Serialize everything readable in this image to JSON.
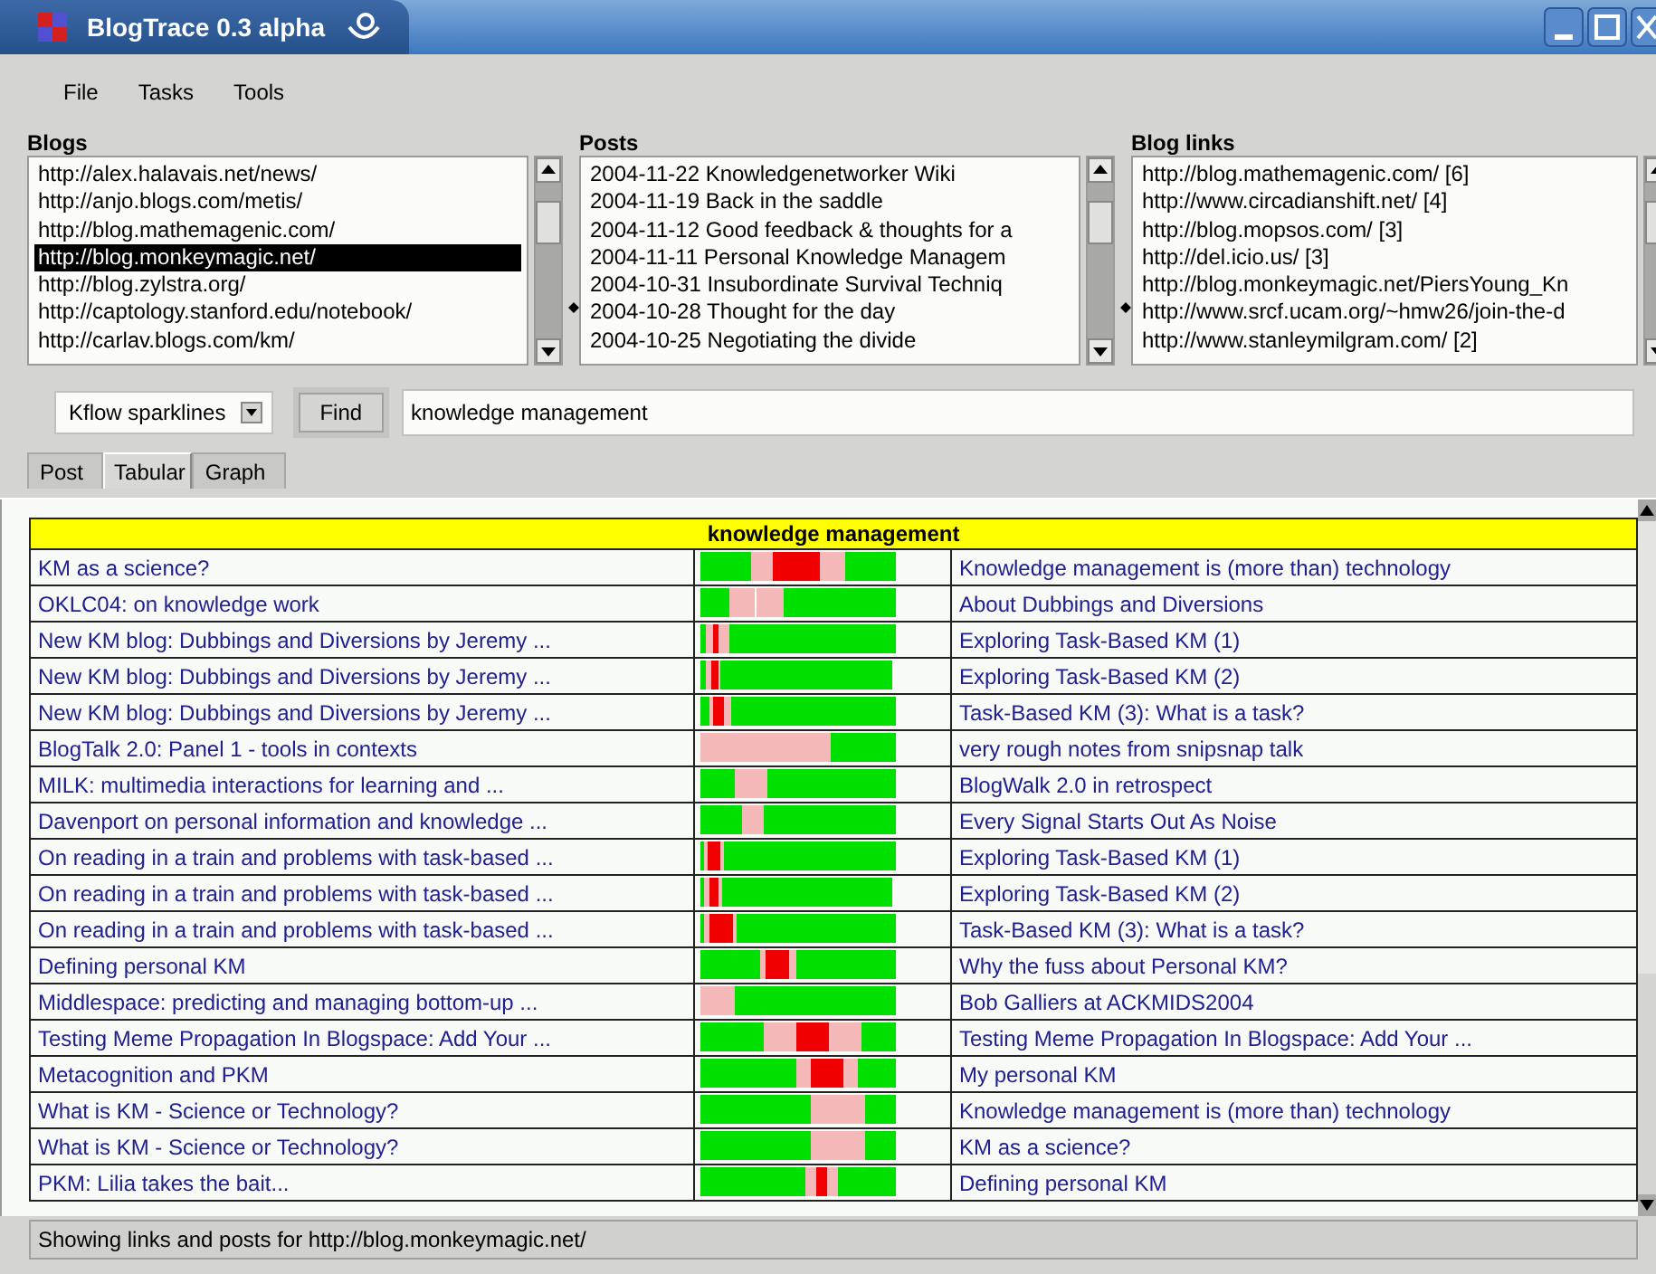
{
  "window": {
    "title": "BlogTrace 0.3 alpha"
  },
  "menu": [
    {
      "label": "File"
    },
    {
      "label": "Tasks"
    },
    {
      "label": "Tools"
    }
  ],
  "panels": [
    {
      "label": "Blogs",
      "items": [
        {
          "text": "http://alex.halavais.net/news/",
          "selected": false
        },
        {
          "text": "http://anjo.blogs.com/metis/",
          "selected": false
        },
        {
          "text": "http://blog.mathemagenic.com/",
          "selected": false
        },
        {
          "text": "http://blog.monkeymagic.net/",
          "selected": true
        },
        {
          "text": "http://blog.zylstra.org/",
          "selected": false
        },
        {
          "text": "http://captology.stanford.edu/notebook/",
          "selected": false
        },
        {
          "text": "http://carlav.blogs.com/km/",
          "selected": false
        }
      ]
    },
    {
      "label": "Posts",
      "items": [
        {
          "text": "2004-11-22 Knowledgenetworker Wiki",
          "selected": false
        },
        {
          "text": "2004-11-19 Back in the saddle",
          "selected": false
        },
        {
          "text": "2004-11-12 Good feedback & thoughts for a",
          "selected": false
        },
        {
          "text": "2004-11-11 Personal Knowledge Managem",
          "selected": false
        },
        {
          "text": "2004-10-31 Insubordinate Survival Techniq",
          "selected": false
        },
        {
          "text": "2004-10-28 Thought for the day",
          "selected": false
        },
        {
          "text": "2004-10-25 Negotiating the divide",
          "selected": false
        }
      ]
    },
    {
      "label": "Blog links",
      "items": [
        {
          "text": "http://blog.mathemagenic.com/ [6]",
          "selected": false
        },
        {
          "text": "http://www.circadianshift.net/ [4]",
          "selected": false
        },
        {
          "text": "http://blog.mopsos.com/ [3]",
          "selected": false
        },
        {
          "text": "http://del.icio.us/ [3]",
          "selected": false
        },
        {
          "text": "http://blog.monkeymagic.net/PiersYoung_Kn",
          "selected": false
        },
        {
          "text": "http://www.srcf.ucam.org/~hmw26/join-the-d",
          "selected": false
        },
        {
          "text": "http://www.stanleymilgram.com/ [2]",
          "selected": false
        }
      ]
    }
  ],
  "toolbar": {
    "view_select": {
      "value": "Kflow sparklines"
    },
    "find_button": {
      "label": "Find"
    },
    "search_field": {
      "value": "knowledge management"
    }
  },
  "tabs": [
    {
      "label": "Post",
      "selected": false
    },
    {
      "label": "Tabular",
      "selected": true
    },
    {
      "label": "Graph",
      "selected": false
    }
  ],
  "table": {
    "title": "knowledge management",
    "rows": [
      {
        "post": "KM as a science?",
        "link": "Knowledge management is (more than) technology"
      },
      {
        "post": "OKLC04: on knowledge work",
        "link": "About Dubbings and Diversions"
      },
      {
        "post": "New KM blog: Dubbings and Diversions by Jeremy  ...",
        "link": "Exploring Task-Based KM (1)"
      },
      {
        "post": "New KM blog: Dubbings and Diversions by Jeremy  ...",
        "link": "Exploring Task-Based KM (2)"
      },
      {
        "post": "New KM blog: Dubbings and Diversions by Jeremy  ...",
        "link": "Task-Based KM (3): What is a task?"
      },
      {
        "post": "BlogTalk 2.0: Panel 1 - tools in contexts",
        "link": "very rough notes from snipsnap talk"
      },
      {
        "post": "MILK: multimedia interactions for learning and  ...",
        "link": "BlogWalk 2.0 in retrospect"
      },
      {
        "post": "Davenport on personal information and knowledge  ...",
        "link": "Every Signal Starts Out As Noise"
      },
      {
        "post": "On reading in a train and problems with task-based  ...",
        "link": "Exploring Task-Based KM (1)"
      },
      {
        "post": "On reading in a train and problems with task-based  ...",
        "link": "Exploring Task-Based KM (2)"
      },
      {
        "post": "On reading in a train and problems with task-based  ...",
        "link": "Task-Based KM (3): What is a task?"
      },
      {
        "post": "Defining personal KM",
        "link": "Why the fuss about Personal KM?"
      },
      {
        "post": "Middlespace: predicting and managing bottom-up  ...",
        "link": "Bob Galliers at ACKMIDS2004"
      },
      {
        "post": "Testing Meme Propagation In Blogspace: Add Your  ...",
        "link": "Testing Meme Propagation In Blogspace: Add Your  ..."
      },
      {
        "post": "Metacognition and PKM",
        "link": "My personal KM"
      },
      {
        "post": "What is KM - Science or Technology?",
        "link": "Knowledge management is (more than) technology"
      },
      {
        "post": "What is KM - Science or Technology?",
        "link": "KM as a science?"
      },
      {
        "post": "PKM: Lilia takes the bait...",
        "link": "Defining personal KM"
      }
    ]
  },
  "status_bar": {
    "text": "Showing links and posts for http://blog.monkeymagic.net/"
  }
}
